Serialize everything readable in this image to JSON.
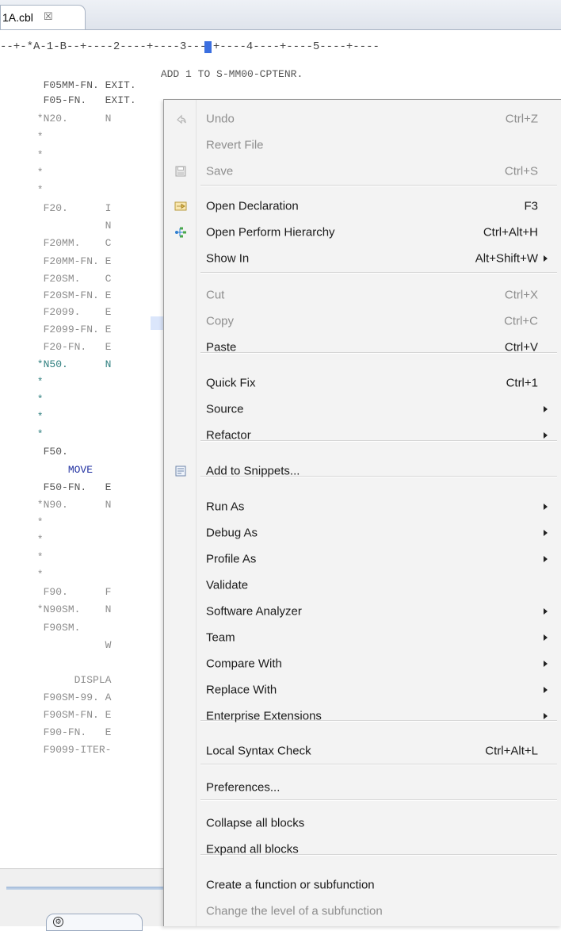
{
  "editor": {
    "tab_label": "1A.cbl",
    "tab_close": "☒",
    "ruler": "--+-*A-1-B--+----2----+----3----+----4----+----5----+----",
    "code_lines": [
      {
        "text": "                          ADD 1 TO S-MM00-CPTENR.",
        "style": "dark"
      },
      {
        "text": "       F05MM-FN. EXIT.",
        "style": "dark"
      },
      {
        "text": "       F05-FN.   EXIT.",
        "style": "dark"
      },
      {
        "text": "      *N20.      N",
        "style": ""
      },
      {
        "text": "      *",
        "style": ""
      },
      {
        "text": "      *",
        "style": ""
      },
      {
        "text": "      *",
        "style": ""
      },
      {
        "text": "      *",
        "style": ""
      },
      {
        "text": "       F20.      I",
        "style": ""
      },
      {
        "text": "                 N",
        "style": ""
      },
      {
        "text": "       F20MM.    C",
        "style": ""
      },
      {
        "text": "       F20MM-FN. E",
        "style": ""
      },
      {
        "text": "       F20SM.    C",
        "style": ""
      },
      {
        "text": "       F20SM-FN. E",
        "style": ""
      },
      {
        "text": "       F2099.    E",
        "style": ""
      },
      {
        "text": "       F2099-FN. E",
        "style": ""
      },
      {
        "text": "       F20-FN.   E",
        "style": ""
      },
      {
        "text": "      *N50.      N",
        "style": "teal"
      },
      {
        "text": "      *",
        "style": "teal"
      },
      {
        "text": "      *",
        "style": "teal"
      },
      {
        "text": "      *",
        "style": "teal"
      },
      {
        "text": "      *",
        "style": "teal"
      },
      {
        "text": "       F50.",
        "style": "dark"
      },
      {
        "text": "           MOVE",
        "style": "navy"
      },
      {
        "text": "       F50-FN.   E",
        "style": "dark"
      },
      {
        "text": "      *N90.      N",
        "style": ""
      },
      {
        "text": "      *",
        "style": ""
      },
      {
        "text": "      *",
        "style": ""
      },
      {
        "text": "      *",
        "style": ""
      },
      {
        "text": "      *",
        "style": ""
      },
      {
        "text": "       F90.      F",
        "style": ""
      },
      {
        "text": "      *N90SM.    N",
        "style": ""
      },
      {
        "text": "       F90SM.",
        "style": ""
      },
      {
        "text": "                 W",
        "style": ""
      },
      {
        "text": "",
        "style": ""
      },
      {
        "text": "            DISPLA",
        "style": ""
      },
      {
        "text": "       F90SM-99. A",
        "style": ""
      },
      {
        "text": "       F90SM-FN. E",
        "style": ""
      },
      {
        "text": "       F90-FN.   E",
        "style": ""
      },
      {
        "text": "       F9099-ITER-",
        "style": ""
      }
    ]
  },
  "context_menu": {
    "items": [
      {
        "label": "Undo",
        "shortcut": "Ctrl+Z",
        "disabled": true,
        "icon": "undo-icon"
      },
      {
        "label": "Revert File",
        "shortcut": "",
        "disabled": true,
        "icon": ""
      },
      {
        "label": "Save",
        "shortcut": "Ctrl+S",
        "disabled": true,
        "icon": "save-icon"
      },
      {
        "label": "Open Declaration",
        "shortcut": "F3",
        "disabled": false,
        "icon": "open-declaration-icon"
      },
      {
        "label": "Open Perform Hierarchy",
        "shortcut": "Ctrl+Alt+H",
        "disabled": false,
        "icon": "hierarchy-icon"
      },
      {
        "label": "Show In",
        "shortcut": "Alt+Shift+W",
        "disabled": false,
        "icon": "",
        "submenu": true
      },
      {
        "label": "Cut",
        "shortcut": "Ctrl+X",
        "disabled": true,
        "icon": ""
      },
      {
        "label": "Copy",
        "shortcut": "Ctrl+C",
        "disabled": true,
        "icon": ""
      },
      {
        "label": "Paste",
        "shortcut": "Ctrl+V",
        "disabled": false,
        "icon": ""
      },
      {
        "label": "Quick Fix",
        "shortcut": "Ctrl+1",
        "disabled": false,
        "icon": ""
      },
      {
        "label": "Source",
        "shortcut": "",
        "disabled": false,
        "icon": "",
        "submenu": true
      },
      {
        "label": "Refactor",
        "shortcut": "",
        "disabled": false,
        "icon": "",
        "submenu": true
      },
      {
        "label": "Add to Snippets...",
        "shortcut": "",
        "disabled": false,
        "icon": "snippets-icon"
      },
      {
        "label": "Run As",
        "shortcut": "",
        "disabled": false,
        "icon": "",
        "submenu": true
      },
      {
        "label": "Debug As",
        "shortcut": "",
        "disabled": false,
        "icon": "",
        "submenu": true
      },
      {
        "label": "Profile As",
        "shortcut": "",
        "disabled": false,
        "icon": "",
        "submenu": true
      },
      {
        "label": "Validate",
        "shortcut": "",
        "disabled": false,
        "icon": ""
      },
      {
        "label": "Software Analyzer",
        "shortcut": "",
        "disabled": false,
        "icon": "",
        "submenu": true
      },
      {
        "label": "Team",
        "shortcut": "",
        "disabled": false,
        "icon": "",
        "submenu": true
      },
      {
        "label": "Compare With",
        "shortcut": "",
        "disabled": false,
        "icon": "",
        "submenu": true
      },
      {
        "label": "Replace With",
        "shortcut": "",
        "disabled": false,
        "icon": "",
        "submenu": true
      },
      {
        "label": "Enterprise Extensions",
        "shortcut": "",
        "disabled": false,
        "icon": "",
        "submenu": true
      },
      {
        "label": "Local Syntax Check",
        "shortcut": "Ctrl+Alt+L",
        "disabled": false,
        "icon": ""
      },
      {
        "label": "Preferences...",
        "shortcut": "",
        "disabled": false,
        "icon": ""
      },
      {
        "label": "Collapse all blocks",
        "shortcut": "",
        "disabled": false,
        "icon": ""
      },
      {
        "label": "Expand all blocks",
        "shortcut": "",
        "disabled": false,
        "icon": ""
      },
      {
        "label": "Create a function or subfunction",
        "shortcut": "",
        "disabled": false,
        "icon": ""
      },
      {
        "label": "Change the level of a subfunction",
        "shortcut": "",
        "disabled": true,
        "icon": ""
      }
    ]
  }
}
